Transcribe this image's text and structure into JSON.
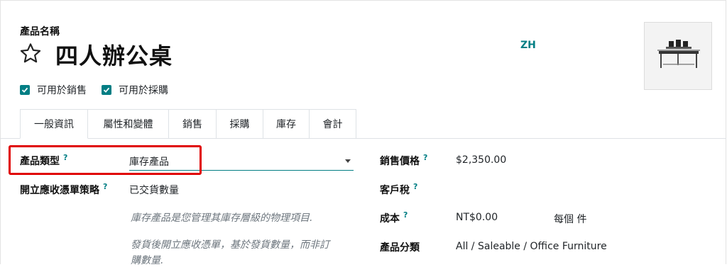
{
  "header": {
    "name_label": "產品名稱",
    "product_name": "四人辦公桌",
    "language": "ZH"
  },
  "checkboxes": [
    {
      "label": "可用於銷售",
      "checked": true
    },
    {
      "label": "可用於採購",
      "checked": true
    }
  ],
  "tabs": [
    "一般資訊",
    "屬性和變體",
    "銷售",
    "採購",
    "庫存",
    "會計"
  ],
  "active_tab": "一般資訊",
  "fields": {
    "product_type": {
      "label": "產品類型",
      "help": "?",
      "value": "庫存產品"
    },
    "invoice_policy": {
      "label": "開立應收憑單策略",
      "help": "?",
      "value": "已交貨數量"
    },
    "product_type_note": "庫存產品是您管理其庫存層級的物理項目.",
    "invoice_note_line1": "發貨後開立應收憑單，基於發貨數量，而非訂",
    "invoice_note_line2": "購數量.",
    "sales_price": {
      "label": "銷售價格",
      "help": "?",
      "value": "$2,350.00"
    },
    "customer_tax": {
      "label": "客戶稅",
      "help": "?"
    },
    "cost": {
      "label": "成本",
      "help": "?",
      "value": "NT$0.00",
      "unit": "每個 件"
    },
    "category": {
      "label": "產品分類",
      "value": "All / Saleable / Office Furniture"
    }
  },
  "colors": {
    "accent": "#017e84",
    "highlight": "#e00000"
  }
}
